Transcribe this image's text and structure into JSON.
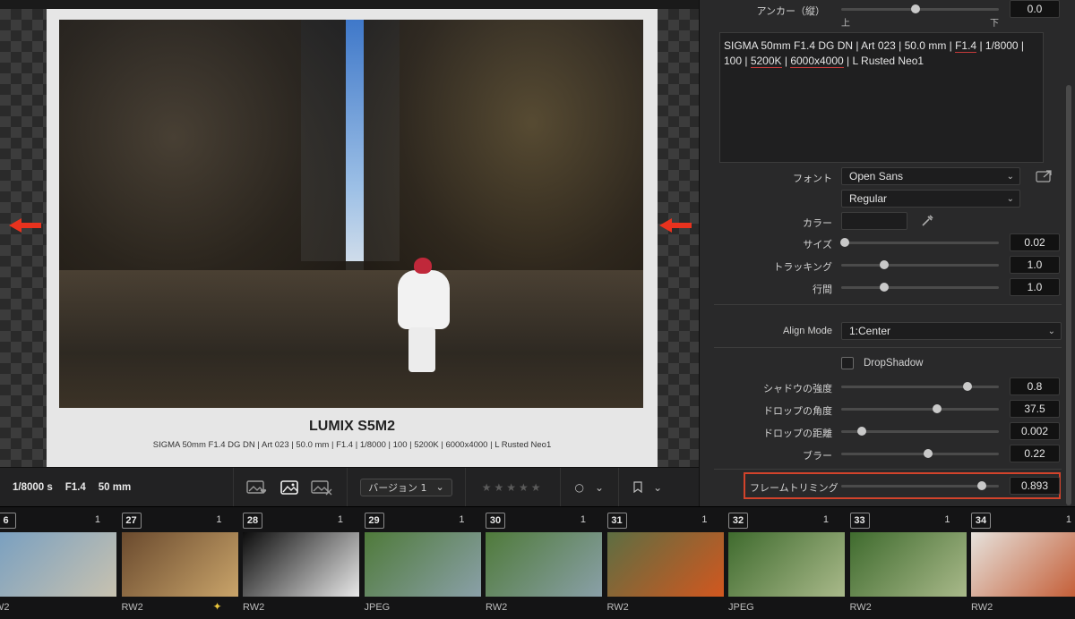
{
  "viewer": {
    "caption_title": "LUMIX S5M2",
    "caption_sub": "SIGMA 50mm F1.4 DG DN | Art 023 | 50.0 mm | F1.4 | 1/8000 | 100 | 5200K | 6000x4000 | L Rusted Neo1"
  },
  "infobar": {
    "shutter": "1/8000 s",
    "aperture": "F1.4",
    "focal": "50 mm",
    "version_label": "バージョン 1",
    "stars": "★★★★★"
  },
  "panel": {
    "anchor_label": "アンカー（縦）",
    "anchor_top": "上",
    "anchor_bottom": "下",
    "anchor_value": "0.0",
    "text_line1_a": "SIGMA 50mm F1.4 DG DN | Art 023 | 50.0 mm | ",
    "text_line1_b": "F1.4",
    "text_line1_c": " | 1/8000 |",
    "text_line2_a": "100 | ",
    "text_line2_b": "5200K",
    "text_line2_c": " | ",
    "text_line2_d": "6000x4000",
    "text_line2_e": " | L Rusted Neo1",
    "font_label": "フォント",
    "font_value": "Open Sans",
    "style_value": "Regular",
    "color_label": "カラー",
    "size_label": "サイズ",
    "size_value": "0.02",
    "tracking_label": "トラッキング",
    "tracking_value": "1.0",
    "leading_label": "行間",
    "leading_value": "1.0",
    "align_label": "Align Mode",
    "align_value": "1:Center",
    "dropshadow_label": "DropShadow",
    "shadow_strength_label": "シャドウの強度",
    "shadow_strength_value": "0.8",
    "drop_angle_label": "ドロップの角度",
    "drop_angle_value": "37.5",
    "drop_distance_label": "ドロップの距離",
    "drop_distance_value": "0.002",
    "blur_label": "ブラー",
    "blur_value": "0.22",
    "frame_trim_label": "フレームトリミング",
    "frame_trim_value": "0.893",
    "levels": {
      "anchor": 0.47,
      "size": 0.02,
      "tracking": 0.27,
      "leading": 0.27,
      "shadow_strength": 0.8,
      "drop_angle": 0.61,
      "drop_distance": 0.13,
      "blur": 0.55,
      "frame_trim": 0.893
    }
  },
  "filmstrip": [
    {
      "num": "6",
      "count": "1",
      "format": "W2",
      "colors": [
        "#7aa0c0",
        "#c8c2b0"
      ]
    },
    {
      "num": "27",
      "count": "1",
      "format": "RW2",
      "colors": [
        "#6a4a2e",
        "#c9a46a"
      ],
      "starred": true
    },
    {
      "num": "28",
      "count": "1",
      "format": "RW2",
      "colors": [
        "#0d0d0d",
        "#e8e8e8"
      ]
    },
    {
      "num": "29",
      "count": "1",
      "format": "JPEG",
      "colors": [
        "#4f7a3a",
        "#8aa0a8"
      ]
    },
    {
      "num": "30",
      "count": "1",
      "format": "RW2",
      "colors": [
        "#4f7a3a",
        "#8aa0a8"
      ]
    },
    {
      "num": "31",
      "count": "1",
      "format": "RW2",
      "colors": [
        "#5d6e42",
        "#d2571f"
      ]
    },
    {
      "num": "32",
      "count": "1",
      "format": "JPEG",
      "colors": [
        "#3f6b2e",
        "#a9b98a"
      ]
    },
    {
      "num": "33",
      "count": "1",
      "format": "RW2",
      "colors": [
        "#3f6b2e",
        "#a9b98a"
      ]
    },
    {
      "num": "34",
      "count": "1",
      "format": "RW2",
      "colors": [
        "#e6e2dc",
        "#c2552c"
      ]
    }
  ]
}
